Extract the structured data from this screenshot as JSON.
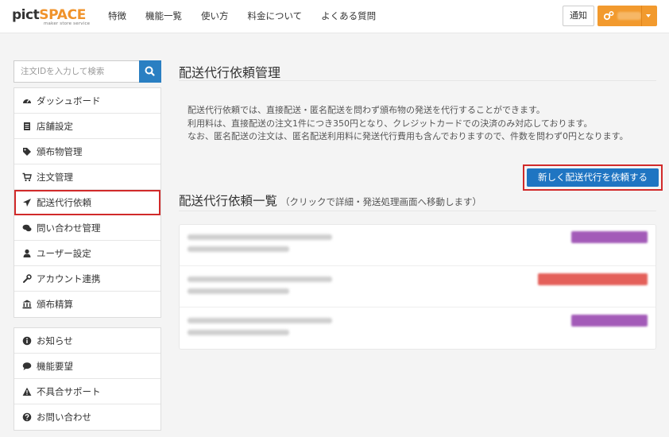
{
  "header": {
    "logo_pict": "pict",
    "logo_space": "SPACE",
    "logo_tagline": "maker store service",
    "nav": [
      "特徴",
      "機能一覧",
      "使い方",
      "料金について",
      "よくある質問"
    ],
    "notice_label": "通知",
    "colors": {
      "accent": "#f29a2e",
      "primary": "#1f75c2",
      "highlight": "#d12a2a"
    }
  },
  "sidebar": {
    "search_placeholder": "注文IDを入力して検索",
    "menu": [
      {
        "label": "ダッシュボード",
        "icon": "dashboard-icon"
      },
      {
        "label": "店舗設定",
        "icon": "store-icon"
      },
      {
        "label": "頒布物管理",
        "icon": "tag-icon"
      },
      {
        "label": "注文管理",
        "icon": "cart-icon"
      },
      {
        "label": "配送代行依頼",
        "icon": "send-icon",
        "active": true
      },
      {
        "label": "問い合わせ管理",
        "icon": "chat-icon"
      },
      {
        "label": "ユーザー設定",
        "icon": "user-icon"
      },
      {
        "label": "アカウント連携",
        "icon": "wrench-icon"
      },
      {
        "label": "頒布精算",
        "icon": "bank-icon"
      }
    ],
    "support": [
      {
        "label": "お知らせ",
        "icon": "info-icon"
      },
      {
        "label": "機能要望",
        "icon": "comment-icon"
      },
      {
        "label": "不具合サポート",
        "icon": "warning-icon"
      },
      {
        "label": "お問い合わせ",
        "icon": "question-icon"
      }
    ]
  },
  "main": {
    "title": "配送代行依頼管理",
    "description": [
      "配送代行依頼では、直接配送・匿名配送を問わず頒布物の発送を代行することができます。",
      "利用料は、直接配送の注文1件につき350円となり、クレジットカードでの決済のみ対応しております。",
      "なお、匿名配送の注文は、匿名配送利用料に発送代行費用も含んでおりますので、件数を問わず0円となります。"
    ],
    "new_request_button": "新しく配送代行を依頼する",
    "list_title": "配送代行依頼一覧",
    "list_subtitle": "（クリックで詳細・発送処理画面へ移動します）"
  }
}
